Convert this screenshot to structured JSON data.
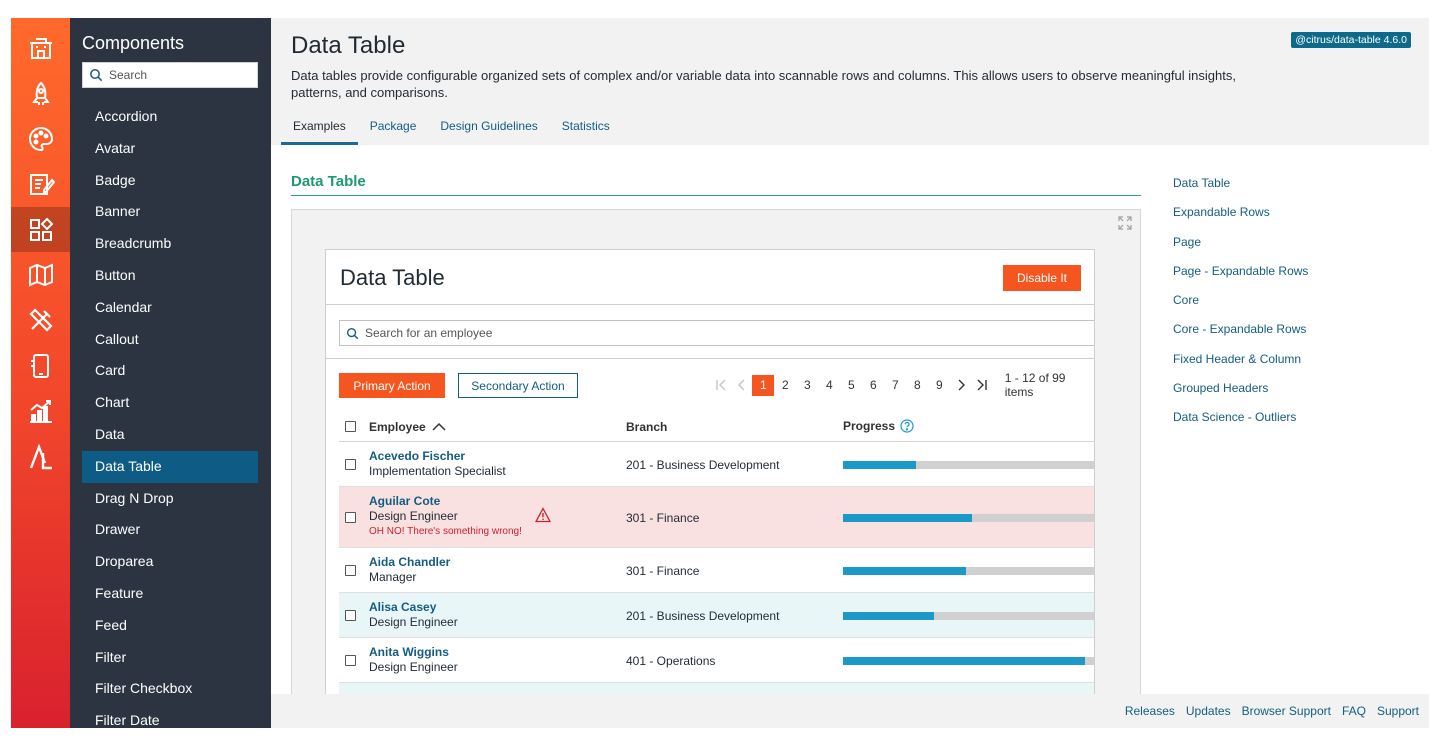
{
  "rail": {
    "icons": [
      "building-icon",
      "rocket-icon",
      "palette-icon",
      "notepad-icon",
      "components-grid-icon",
      "map-icon",
      "tools-icon",
      "mobile-icon",
      "chart-growth-icon",
      "citrus-logo-icon"
    ],
    "active_index": 4
  },
  "sidebar": {
    "title": "Components",
    "search_placeholder": "Search",
    "items": [
      "Accordion",
      "Avatar",
      "Badge",
      "Banner",
      "Breadcrumb",
      "Button",
      "Calendar",
      "Callout",
      "Card",
      "Chart",
      "Data",
      "Data Table",
      "Drag N Drop",
      "Drawer",
      "Droparea",
      "Feature",
      "Feed",
      "Filter",
      "Filter Checkbox",
      "Filter Date"
    ],
    "active_item": "Data Table"
  },
  "header": {
    "title": "Data Table",
    "version": "@citrus/data-table 4.6.0",
    "description": "Data tables provide configurable organized sets of complex and/or variable data into scannable rows and columns. This allows users to observe meaningful insights, patterns, and comparisons.",
    "tabs": [
      "Examples",
      "Package",
      "Design Guidelines",
      "Statistics"
    ],
    "active_tab": "Examples"
  },
  "section": {
    "title": "Data Table"
  },
  "card": {
    "title": "Data Table",
    "disable_label": "Disable It",
    "search_placeholder": "Search for an employee",
    "primary_label": "Primary Action",
    "secondary_label": "Secondary Action",
    "pager": {
      "pages": [
        "1",
        "2",
        "3",
        "4",
        "5",
        "6",
        "7",
        "8",
        "9"
      ],
      "current": "1",
      "info": "1 - 12 of 99 items"
    },
    "columns": {
      "employee": "Employee",
      "branch": "Branch",
      "progress": "Progress"
    },
    "rows": [
      {
        "name": "Acevedo Fischer",
        "role": "Implementation Specialist",
        "branch": "201 - Business Development",
        "progress": 29,
        "state": "normal"
      },
      {
        "name": "Aguilar Cote",
        "role": "Design Engineer",
        "branch": "301 - Finance",
        "progress": 51,
        "state": "error",
        "error": "OH NO! There's something wrong!"
      },
      {
        "name": "Aida Chandler",
        "role": "Manager",
        "branch": "301 - Finance",
        "progress": 49,
        "state": "normal"
      },
      {
        "name": "Alisa Casey",
        "role": "Design Engineer",
        "branch": "201 - Business Development",
        "progress": 36,
        "state": "striped"
      },
      {
        "name": "Anita Wiggins",
        "role": "Design Engineer",
        "branch": "401 - Operations",
        "progress": 96,
        "state": "normal"
      },
      {
        "name": "",
        "role": "",
        "branch": "",
        "progress": 0,
        "state": "striped"
      }
    ]
  },
  "toc": [
    "Data Table",
    "Expandable Rows",
    "Page",
    "Page - Expandable Rows",
    "Core",
    "Core - Expandable Rows",
    "Fixed Header & Column",
    "Grouped Headers",
    "Data Science - Outliers"
  ],
  "footer": {
    "links": [
      "Releases",
      "Updates",
      "Browser Support",
      "FAQ",
      "Support"
    ]
  },
  "colors": {
    "accent": "#f5561f",
    "link": "#145d80",
    "success": "#1e9a6e",
    "sidebar": "#2b3440",
    "active_nav": "#0e5c85",
    "progress": "#1b9ac9"
  }
}
